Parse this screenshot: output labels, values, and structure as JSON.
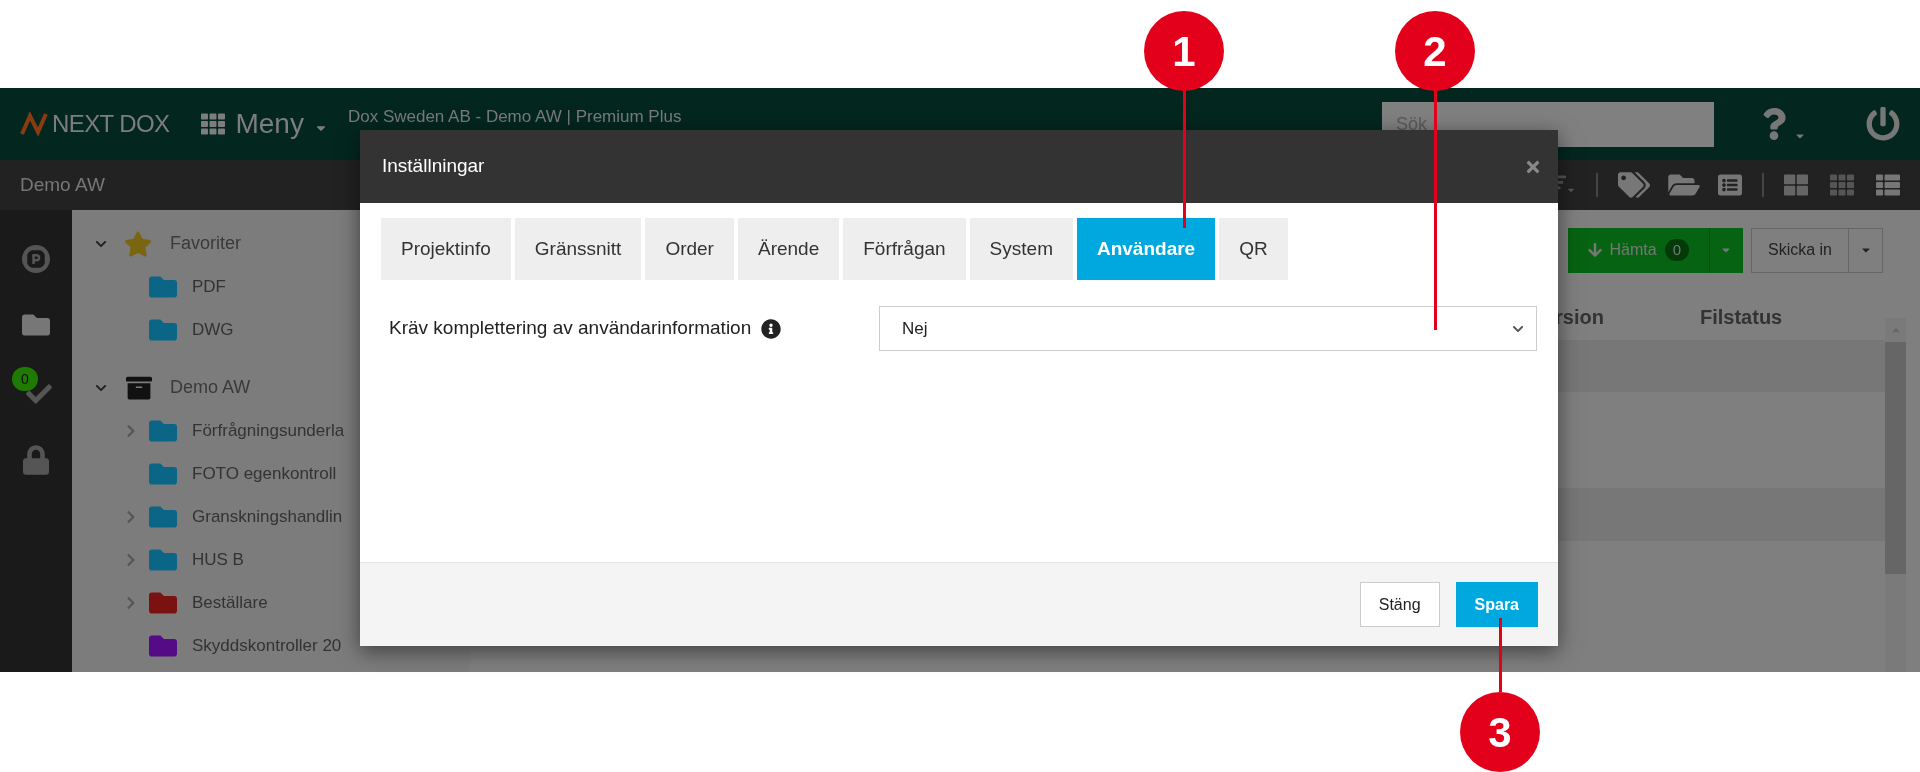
{
  "top_bar": {
    "logo": "NEXT DOX",
    "menu": "Meny",
    "breadcrumb": "Dox Sweden AB - Demo AW | Premium Plus",
    "search": {
      "placeholder": "Sök"
    }
  },
  "sub_bar": {
    "title": "Demo AW"
  },
  "rail": {
    "badge": "0"
  },
  "tree": [
    {
      "label": "Favoriter",
      "kind": "favorites",
      "expanded": true,
      "children": [
        {
          "label": "PDF",
          "color": "#0b6587",
          "expandable": false
        },
        {
          "label": "DWG",
          "color": "#0b6587",
          "expandable": false
        }
      ]
    },
    {
      "label": "Demo AW",
      "kind": "archive",
      "expanded": true,
      "children": [
        {
          "label": "Förfrågningsunderla",
          "color": "#0b6587",
          "expandable": true
        },
        {
          "label": "FOTO egenkontroll",
          "color": "#0b6587",
          "expandable": false
        },
        {
          "label": "Granskningshandlin",
          "color": "#0b6587",
          "expandable": true
        },
        {
          "label": "HUS B",
          "color": "#0b6587",
          "expandable": true
        },
        {
          "label": "Beställare",
          "color": "#7a1212",
          "expandable": true
        },
        {
          "label": "Skyddskontroller 20",
          "color": "#550b86",
          "expandable": false
        }
      ]
    }
  ],
  "actions": {
    "download": {
      "label": "Hämta",
      "count": "0"
    },
    "submit": "Skicka in"
  },
  "table": {
    "columns": [
      "rsion",
      "Filstatus"
    ]
  },
  "dialog": {
    "title": "Inställningar",
    "tabs": [
      {
        "label": "Projektinfo",
        "selected": false
      },
      {
        "label": "Gränssnitt",
        "selected": false
      },
      {
        "label": "Order",
        "selected": false
      },
      {
        "label": "Ärende",
        "selected": false
      },
      {
        "label": "Förfrågan",
        "selected": false
      },
      {
        "label": "System",
        "selected": false
      },
      {
        "label": "Användare",
        "selected": true
      },
      {
        "label": "QR",
        "selected": false
      }
    ],
    "field": {
      "label": "Kräv komplettering av användarinformation",
      "value": "Nej"
    },
    "buttons": [
      {
        "label": "Stäng",
        "kind": "secondary"
      },
      {
        "label": "Spara",
        "kind": "primary"
      }
    ]
  },
  "callouts": [
    {
      "label": "1"
    },
    {
      "label": "2"
    },
    {
      "label": "3"
    }
  ]
}
